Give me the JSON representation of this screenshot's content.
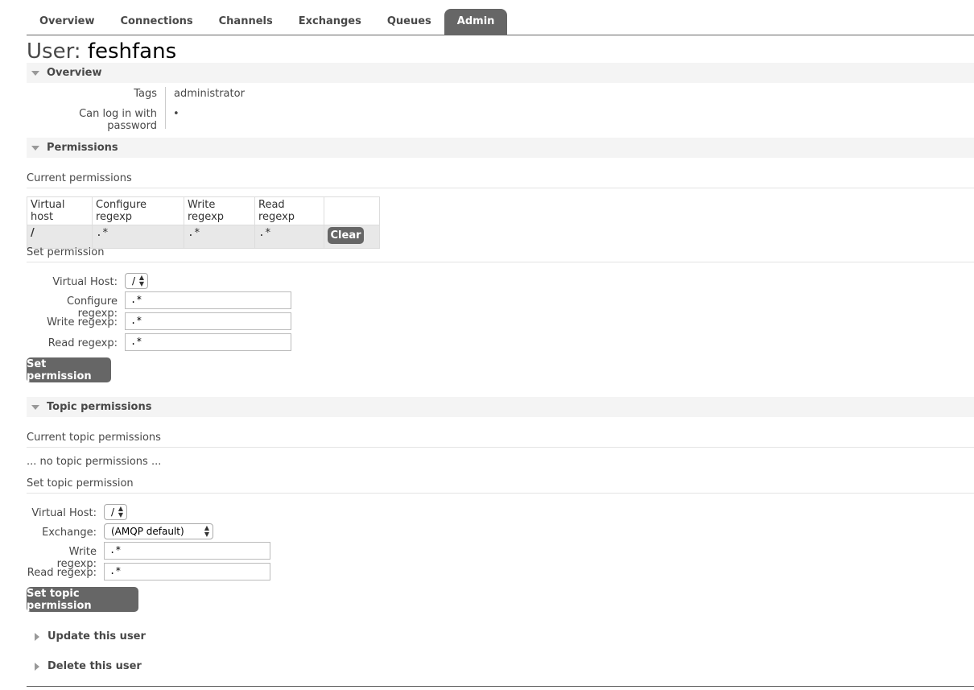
{
  "nav": {
    "tabs": [
      {
        "label": "Overview"
      },
      {
        "label": "Connections"
      },
      {
        "label": "Channels"
      },
      {
        "label": "Exchanges"
      },
      {
        "label": "Queues"
      },
      {
        "label": "Admin"
      }
    ],
    "active": "Admin"
  },
  "page": {
    "title_prefix": "User:",
    "username": "feshfans"
  },
  "overview": {
    "heading": "Overview",
    "tags_label": "Tags",
    "tags_value": "administrator",
    "login_label": "Can log in with password",
    "login_value": "•"
  },
  "permissions": {
    "heading": "Permissions",
    "current_heading": "Current permissions",
    "columns": [
      "Virtual host",
      "Configure regexp",
      "Write regexp",
      "Read regexp",
      ""
    ],
    "rows": [
      {
        "vhost": "/",
        "configure": ".*",
        "write": ".*",
        "read": ".*",
        "action": "Clear"
      }
    ],
    "set_heading": "Set permission",
    "form": {
      "vhost_label": "Virtual Host:",
      "vhost_value": "/",
      "configure_label": "Configure regexp:",
      "configure_value": ".*",
      "write_label": "Write regexp:",
      "write_value": ".*",
      "read_label": "Read regexp:",
      "read_value": ".*",
      "submit": "Set permission"
    }
  },
  "topic_permissions": {
    "heading": "Topic permissions",
    "current_heading": "Current topic permissions",
    "empty_text": "... no topic permissions ...",
    "set_heading": "Set topic permission",
    "form": {
      "vhost_label": "Virtual Host:",
      "vhost_value": "/",
      "exchange_label": "Exchange:",
      "exchange_value": "(AMQP default)",
      "write_label": "Write regexp:",
      "write_value": ".*",
      "read_label": "Read regexp:",
      "read_value": ".*",
      "submit": "Set topic permission"
    }
  },
  "collapsed_sections": {
    "update": "Update this user",
    "delete": "Delete this user"
  }
}
